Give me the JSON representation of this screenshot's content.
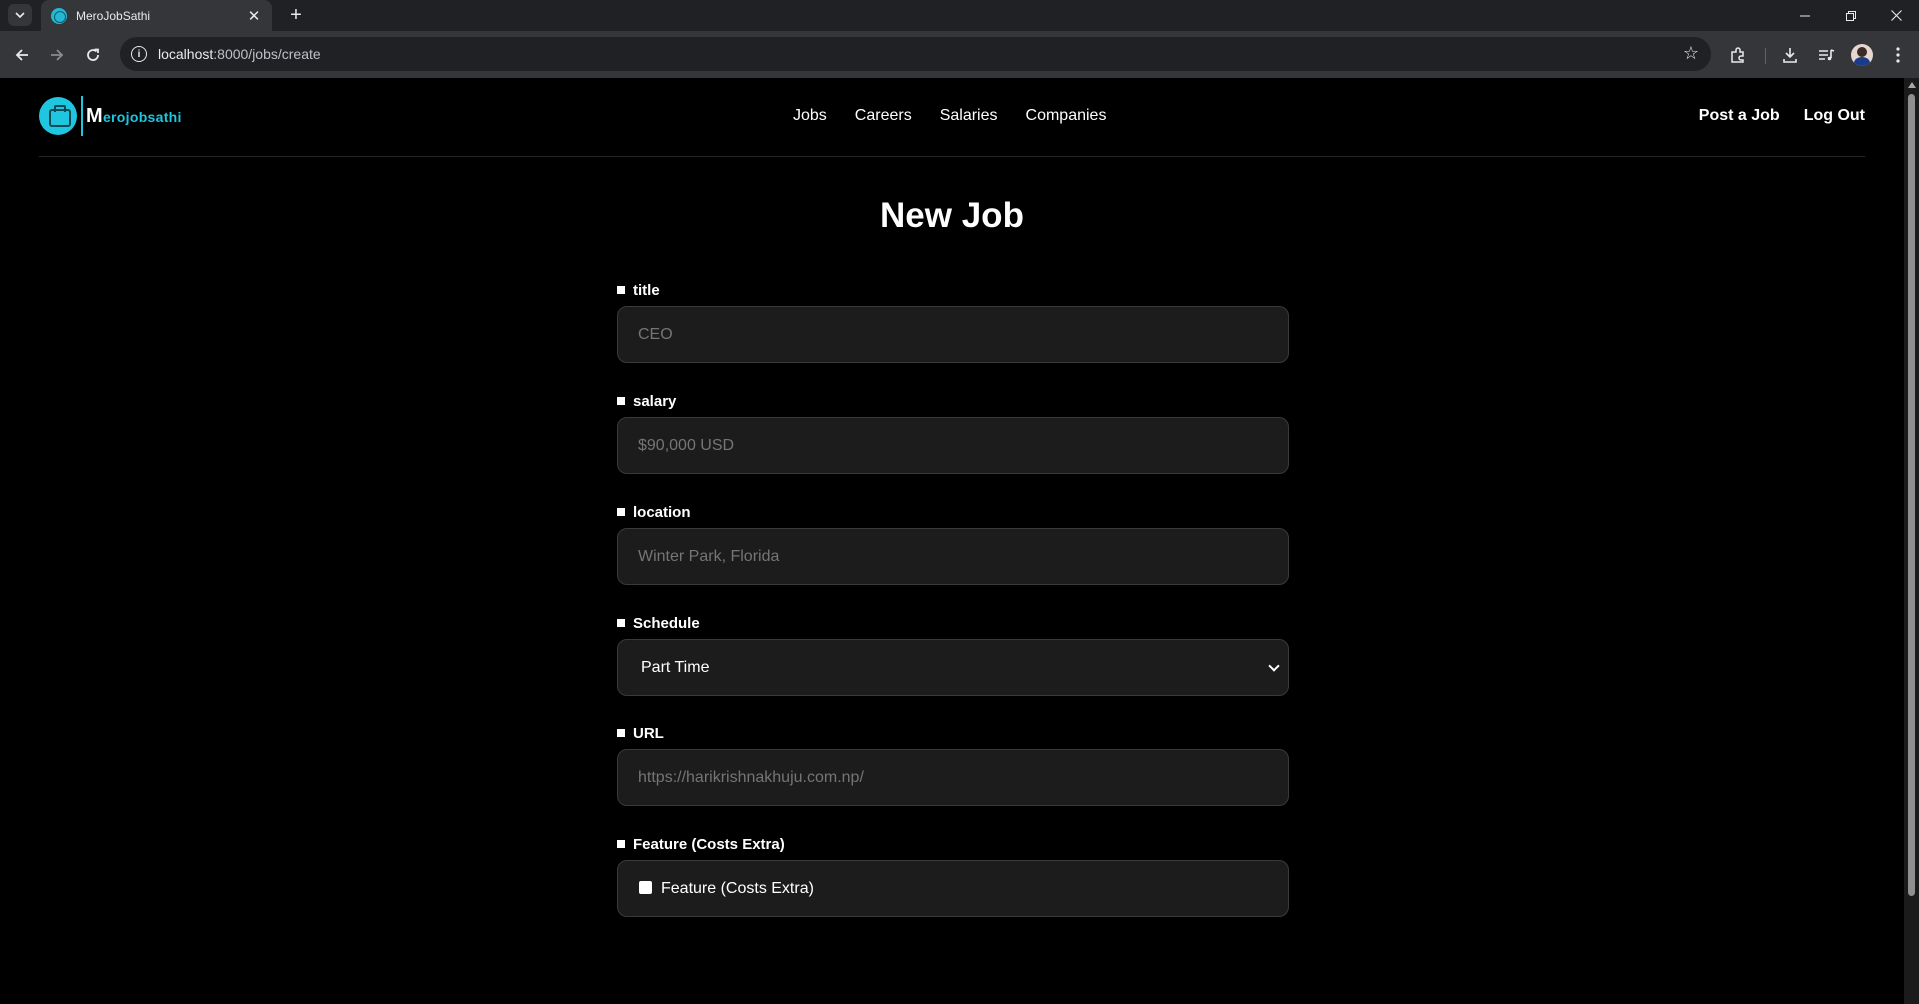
{
  "browser": {
    "tab_title": "MeroJobSathi",
    "url_host": "localhost",
    "url_rest": ":8000/jobs/create",
    "new_tab_symbol": "+",
    "tab_close_symbol": "✕"
  },
  "header": {
    "logo_text_cap": "M",
    "logo_text_rest": "erojobsathi",
    "nav": [
      {
        "label": "Jobs"
      },
      {
        "label": "Careers"
      },
      {
        "label": "Salaries"
      },
      {
        "label": "Companies"
      }
    ],
    "post_job": "Post a Job",
    "logout": "Log Out"
  },
  "page": {
    "title": "New Job"
  },
  "form": {
    "title": {
      "label": "title",
      "placeholder": "CEO"
    },
    "salary": {
      "label": "salary",
      "placeholder": "$90,000 USD"
    },
    "location": {
      "label": "location",
      "placeholder": "Winter Park, Florida"
    },
    "schedule": {
      "label": "Schedule",
      "selected": "Part Time"
    },
    "url": {
      "label": "URL",
      "placeholder": "https://harikrishnakhuju.com.np/"
    },
    "featured": {
      "label": "Feature (Costs Extra)",
      "checkbox_label": "Feature (Costs Extra)",
      "checked": false
    }
  },
  "colors": {
    "accent": "#1ec6e0",
    "background": "#000000",
    "input_bg": "#1c1c1c"
  }
}
